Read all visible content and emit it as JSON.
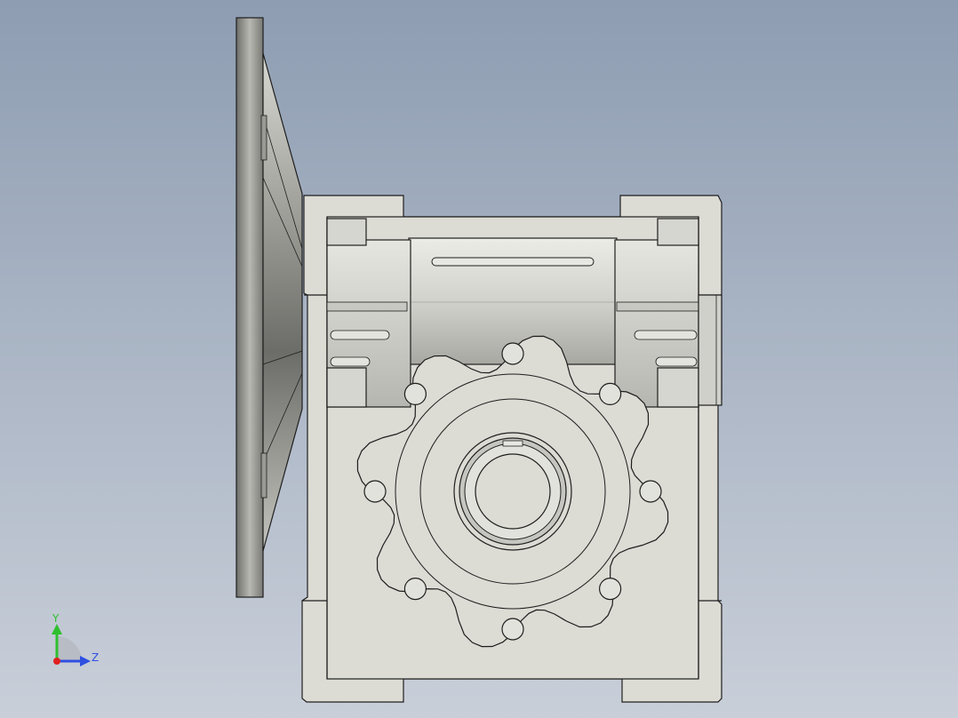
{
  "viewport": {
    "background_top": "#8e9db2",
    "background_bottom": "#c9cfd9"
  },
  "model": {
    "body_color": "#dcdbd4",
    "line_color": "#1e1e1e",
    "flange_color": "#8a8a86"
  },
  "triad": {
    "y_label": "Y",
    "z_label": "Z",
    "y_color": "#2fbf2f",
    "z_color": "#2f4fe0",
    "x_color": "#e02020"
  }
}
